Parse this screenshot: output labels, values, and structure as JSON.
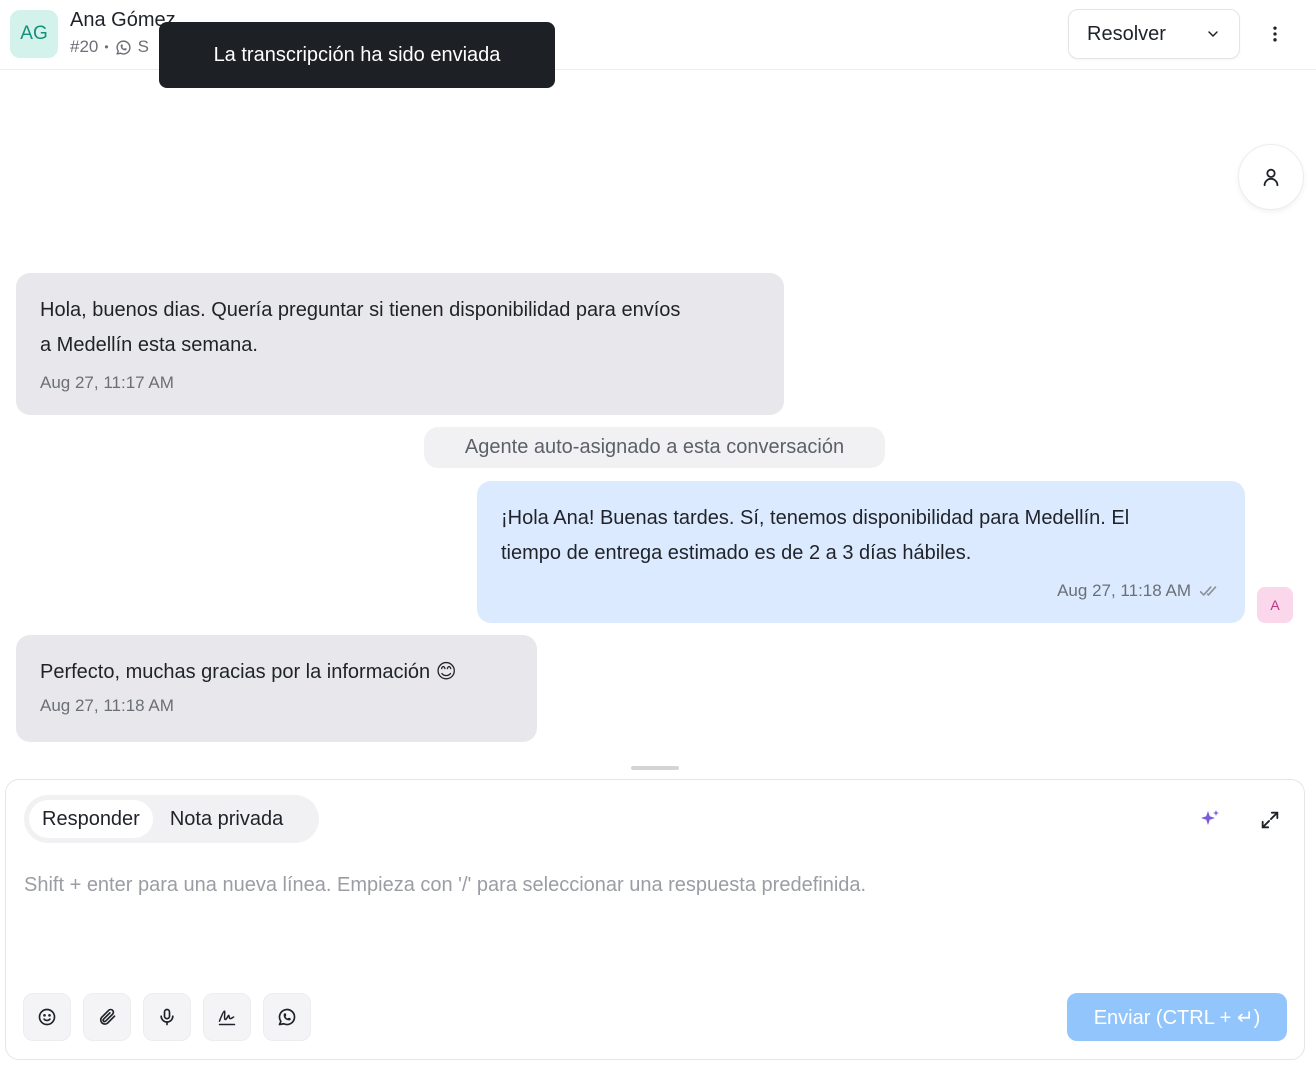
{
  "header": {
    "avatar_initials": "AG",
    "contact_name": "Ana Gómez",
    "conversation_id": "#20",
    "channel_label": "S",
    "resolve_label": "Resolver"
  },
  "toast": {
    "message": "La transcripción ha sido enviada"
  },
  "messages": [
    {
      "direction": "incoming",
      "text_line1": "Hola, buenos dias. Quería preguntar si tienen disponibilidad para envíos",
      "text_line2": "a Medellín esta semana.",
      "time": "Aug 27, 11:17 AM"
    },
    {
      "direction": "outgoing",
      "text_line1": "¡Hola Ana! Buenas tardes. Sí, tenemos disponibilidad para Medellín. El",
      "text_line2": "tiempo de entrega estimado es de 2 a 3 días hábiles.",
      "time": "Aug 27, 11:18 AM",
      "agent_initial": "A"
    },
    {
      "direction": "incoming",
      "text_line1": "Perfecto, muchas gracias por la información 😊",
      "time": "Aug 27, 11:18 AM"
    }
  ],
  "activity": {
    "text": "Agente auto-asignado a esta conversación"
  },
  "composer": {
    "tab_reply": "Responder",
    "tab_private_note": "Nota privada",
    "placeholder": "Shift + enter para una nueva línea. Empieza con '/' para seleccionar una respuesta predefinida.",
    "send_label": "Enviar (CTRL + ↵)",
    "tools": [
      "emoji-icon",
      "paperclip-icon",
      "microphone-icon",
      "signature-icon",
      "whatsapp-icon"
    ]
  },
  "colors": {
    "incoming_bubble": "#e8e8ec",
    "outgoing_bubble": "#dbeafe",
    "send_button": "#93c5fd",
    "toast_bg": "#1d2025",
    "avatar_bg": "#d4f2ec",
    "accent_ai": "#7c5cdb"
  }
}
